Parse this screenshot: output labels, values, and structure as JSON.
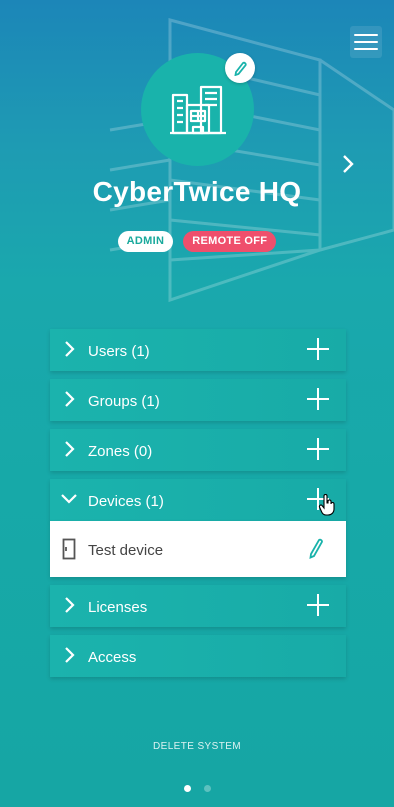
{
  "header": {
    "title": "CyberTwice HQ",
    "badges": {
      "role": "ADMIN",
      "remote": "REMOTE OFF"
    }
  },
  "icons": {
    "menu": "menu-icon",
    "avatar": "building-icon",
    "edit": "pencil-icon",
    "next": "chevron-right-icon"
  },
  "sections": [
    {
      "label": "Users (1)",
      "expanded": false
    },
    {
      "label": "Groups (1)",
      "expanded": false
    },
    {
      "label": "Zones (0)",
      "expanded": false
    },
    {
      "label": "Devices (1)",
      "expanded": true,
      "items": [
        {
          "label": "Test device"
        }
      ]
    },
    {
      "label": "Licenses",
      "expanded": false
    },
    {
      "label": "Access",
      "expanded": false
    }
  ],
  "footer": {
    "delete_label": "DELETE SYSTEM",
    "pages": 2,
    "current_page": 1
  },
  "colors": {
    "accent": "#19b3ab",
    "remote_badge": "#ef4f6c",
    "admin_text": "#19a99c"
  }
}
